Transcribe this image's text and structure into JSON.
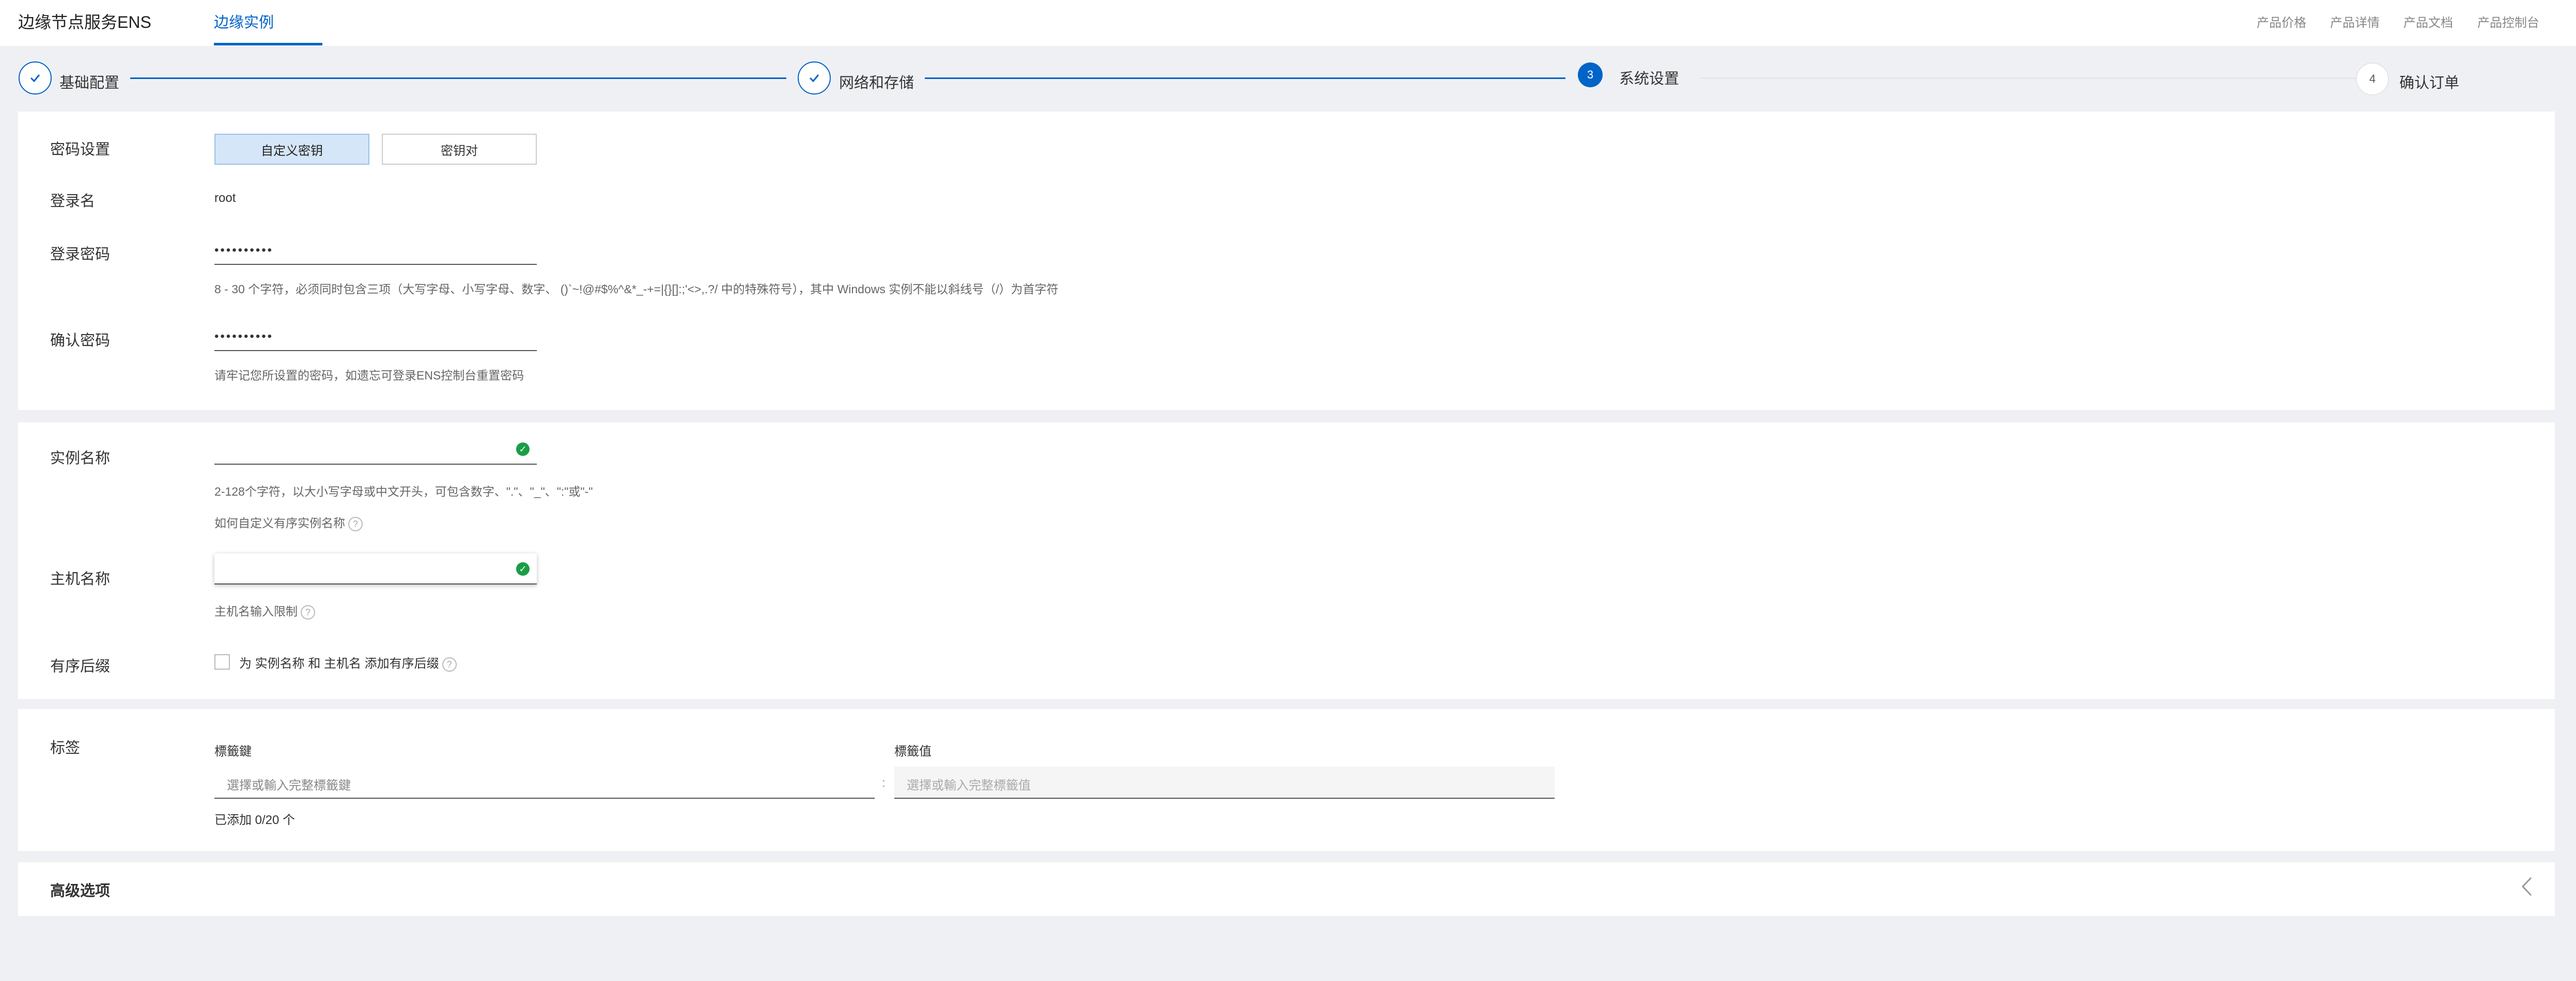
{
  "app_title": "边缘节点服务ENS",
  "main_tab": "边缘实例",
  "top_links": [
    "产品价格",
    "产品详情",
    "产品文档",
    "产品控制台"
  ],
  "steps": [
    {
      "num": "",
      "label": "基础配置",
      "state": "done"
    },
    {
      "num": "",
      "label": "网络和存储",
      "state": "done"
    },
    {
      "num": "3",
      "label": "系统设置",
      "state": "active"
    },
    {
      "num": "4",
      "label": "确认订单",
      "state": "todo"
    }
  ],
  "auth": {
    "password_settings_label": "密码设置",
    "options": [
      "自定义密钥",
      "密钥对"
    ],
    "login_name_label": "登录名",
    "login_name": "root",
    "login_password_label": "登录密码",
    "password_masked": "••••••••••",
    "password_hint": "8 - 30 个字符，必须同时包含三项（大写字母、小写字母、数字、 ()`~!@#$%^&*_-+=|{}[]:;'<>,.?/ 中的特殊符号），其中 Windows 实例不能以斜线号（/）为首字符",
    "confirm_password_label": "确认密码",
    "confirm_masked": "••••••••••",
    "confirm_hint": "请牢记您所设置的密码，如遗忘可登录ENS控制台重置密码"
  },
  "naming": {
    "instance_name_label": "实例名称",
    "instance_name_hint": "2-128个字符，以大小写字母或中文开头，可包含数字、\".\"、\"_\"、\":\"或\"-\"",
    "custom_order_hint": "如何自定义有序实例名称",
    "host_name_label": "主机名称",
    "host_name_hint": "主机名输入限制",
    "ordered_suffix_label": "有序后缀",
    "ordered_suffix_text": "为 实例名称 和 主机名 添加有序后缀"
  },
  "tags": {
    "label": "标签",
    "key_header": "標籤鍵",
    "value_header": "標籤值",
    "key_placeholder": "選擇或輸入完整標籤鍵",
    "value_placeholder": "選擇或輸入完整標籤值",
    "separator": ":",
    "added_count": "已添加 0/20 个"
  },
  "advanced": {
    "label": "高级选项"
  },
  "icons": {
    "step_done": "check-icon",
    "valid": "check-circle-icon",
    "help": "question-circle-icon",
    "collapse": "chevron-left-icon"
  },
  "colors": {
    "accent": "#0064c8",
    "success": "#1a9d45",
    "selected_bg": "#d4e6f8"
  }
}
